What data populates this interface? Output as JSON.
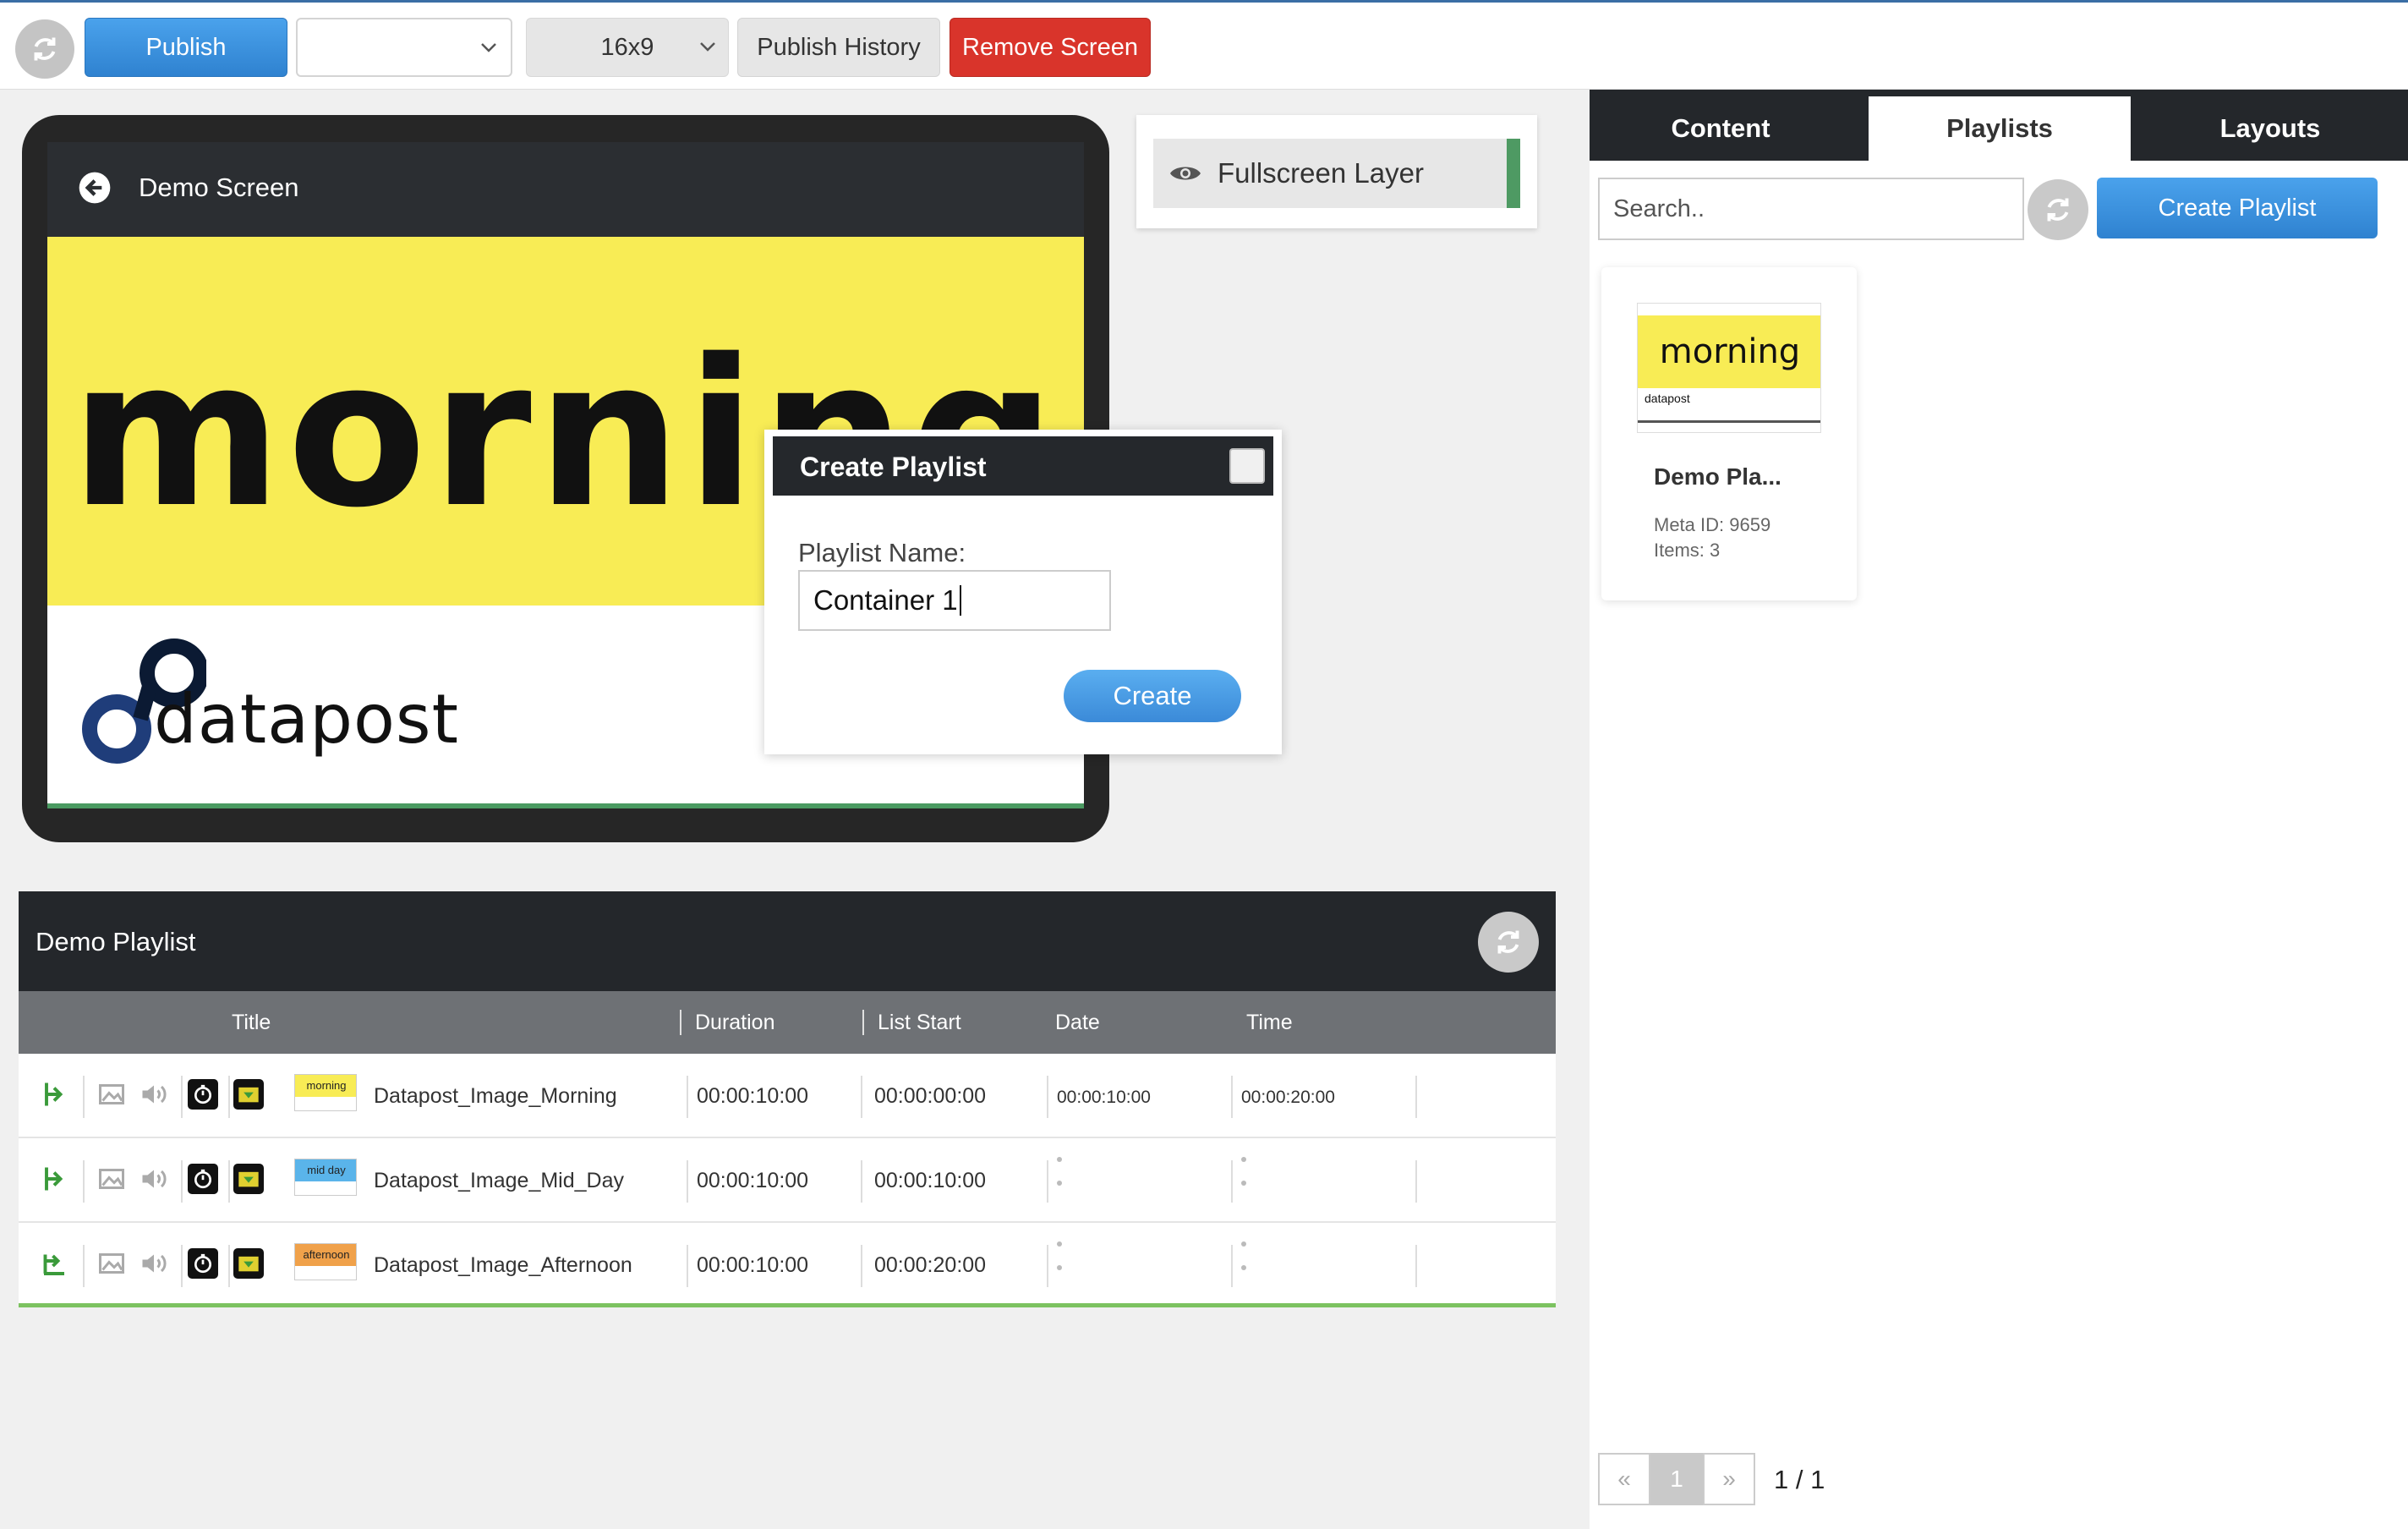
{
  "toolbar": {
    "refresh_icon": "refresh-icon",
    "publish_label": "Publish",
    "screen_select_value": "",
    "ratio_value": "16x9",
    "history_label": "Publish History",
    "remove_label": "Remove Screen"
  },
  "preview": {
    "screen_title": "Demo Screen",
    "headline": "morning",
    "logo_text": "datapost"
  },
  "layers": {
    "item_label": "Fullscreen Layer",
    "accent": "#4e9a63"
  },
  "modal": {
    "title": "Create Playlist",
    "name_label": "Playlist Name:",
    "name_value": "Container 1",
    "create_label": "Create"
  },
  "playlist": {
    "title": "Demo Playlist",
    "columns": [
      "Title",
      "Duration",
      "List Start",
      "Date",
      "Time"
    ],
    "rows": [
      {
        "thumb": "morning",
        "thumb_color": "#f8ec55",
        "title": "Datapost_Image_Morning",
        "duration": "00:00:10:00",
        "list_start": "00:00:00:00",
        "date": "00:00:10:00",
        "time": "00:00:20:00"
      },
      {
        "thumb": "mid day",
        "thumb_color": "#5ab4ea",
        "title": "Datapost_Image_Mid_Day",
        "duration": "00:00:10:00",
        "list_start": "00:00:10:00",
        "date": "",
        "time": ""
      },
      {
        "thumb": "afternoon",
        "thumb_color": "#f0a14a",
        "title": "Datapost_Image_Afternoon",
        "duration": "00:00:10:00",
        "list_start": "00:00:20:00",
        "date": "",
        "time": ""
      }
    ]
  },
  "right_panel": {
    "tabs": [
      "Content",
      "Playlists",
      "Layouts"
    ],
    "active_tab": "Playlists",
    "search_placeholder": "Search..",
    "create_label": "Create Playlist",
    "card": {
      "thumb_text": "morning",
      "thumb_logo": "datapost",
      "name": "Demo Pla...",
      "meta": "Meta ID: 9659",
      "items": "Items: 3"
    },
    "pager": {
      "prev": "«",
      "current": "1",
      "next": "»",
      "summary": "1 / 1"
    }
  }
}
